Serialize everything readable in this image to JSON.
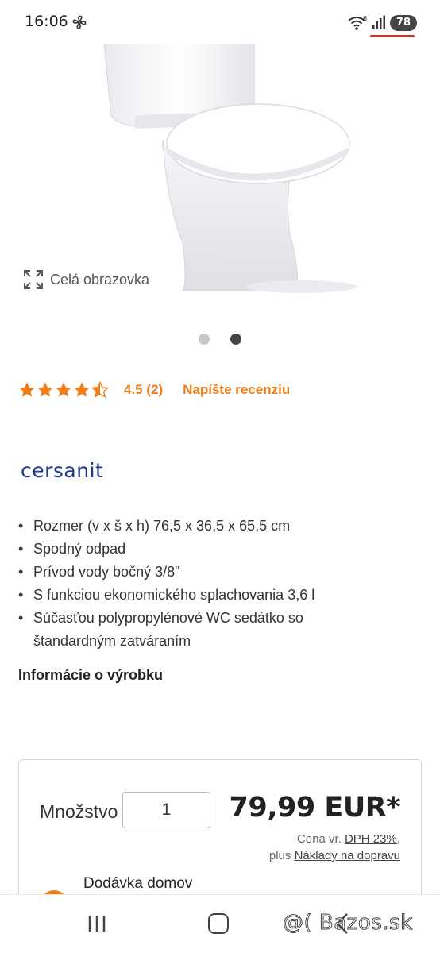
{
  "status_bar": {
    "time": "16:06",
    "battery": "78",
    "network_badge": "6",
    "icons": [
      "fan-icon",
      "wifi-icon",
      "signal-icon",
      "battery-icon"
    ]
  },
  "gallery": {
    "fullscreen_label": "Celá obrazovka",
    "slide_count": 2,
    "active_slide": 2
  },
  "rating": {
    "stars": 4.5,
    "value_text": "4.5 (2)",
    "write_review": "Napíšte recenziu",
    "accent_color": "#f07d1a"
  },
  "brand": {
    "name": "cersanit",
    "color": "#1f3a8a"
  },
  "features": [
    "Rozmer (v x š x h) 76,5 x 36,5 x 65,5 cm",
    "Spodný odpad",
    "Prívod vody bočný 3/8\"",
    "S funkciou ekonomického splachovania 3,6 l",
    "Súčasťou polypropylénové WC sedátko so štandardným zatváraním"
  ],
  "info_link": "Informácie o výrobku",
  "purchase": {
    "quantity_label": "Množstvo",
    "quantity_value": "1",
    "price": "79,99 EUR*",
    "price_note_prefix": "Cena vr.",
    "vat_link": "DPH 23%",
    "vat_suffix": ",",
    "shipping_prefix": "plus",
    "shipping_link": "Náklady na dopravu",
    "delivery_label": "Dodávka domov"
  },
  "navbar": {
    "watermark": "@( Bazos.sk"
  }
}
